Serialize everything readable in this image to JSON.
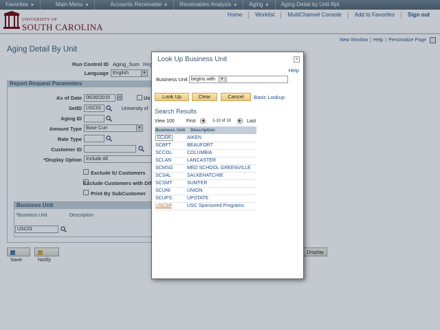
{
  "topnav": {
    "items": [
      {
        "label": "Favorites",
        "dropdown": true
      },
      {
        "label": "Main Menu",
        "dropdown": true
      },
      {
        "label": "Accounts Receivable",
        "dropdown": true
      },
      {
        "label": "Receivables Analysis",
        "dropdown": true
      },
      {
        "label": "Aging",
        "dropdown": true
      },
      {
        "label": "Aging Detail by Unit Rpt",
        "dropdown": false
      }
    ]
  },
  "header": {
    "logo_line1": "UNIVERSITY OF",
    "logo_line2": "SOUTH CAROLINA",
    "links": {
      "home": "Home",
      "worklist": "Worklist",
      "multichannel": "MultiChannel Console",
      "favorites": "Add to Favorites",
      "signout": "Sign out"
    }
  },
  "sublinks": {
    "new_window": "New Window",
    "help": "Help",
    "personalize": "Personalize Page",
    "sep": "|"
  },
  "page": {
    "title": "Aging Detail By Unit",
    "run_control_label": "Run Control ID",
    "run_control_value": "Aging_Sum",
    "run_control_link": "Rep",
    "language_label": "Language",
    "language_value": "English",
    "section_title": "Report Request Parameters",
    "as_of_date_label": "As of Date",
    "as_of_date_value": "06/30/2015",
    "cal_icon_text": "31",
    "use_label": "Us",
    "setid_label": "SetID",
    "setid_value": "USC01",
    "setid_desc": "University of",
    "aging_id_label": "Aging ID",
    "amount_type_label": "Amount Type",
    "amount_type_value": "Base Curr",
    "rate_type_label": "Rate Type",
    "customer_id_label": "Customer ID",
    "display_option_label": "*Display Option",
    "display_option_value": "Include All",
    "exclude_iu_label": "Exclude IU Customers",
    "exclude_cust_label": "Exclude Customers with Dif",
    "print_sub_label": "Print By SubCustomer",
    "bu_section_title": "Business Unit",
    "bu_col1": "*Business Unit",
    "bu_col2": "Description",
    "bu_value": "USC01"
  },
  "bottom": {
    "save": "Save",
    "notify": "Notify",
    "display": "Display"
  },
  "modal": {
    "title": "Look Up Business Unit",
    "close": "×",
    "help": "Help",
    "field_label": "Business Unit",
    "operator": "begins with",
    "search_value": "",
    "buttons": {
      "lookup": "Look Up",
      "clear": "Clear",
      "cancel": "Cancel",
      "basic": "Basic Lookup"
    },
    "results_title": "Search Results",
    "view_label": "View 100",
    "first_label": "First",
    "range_label": "1-10 of 10",
    "last_label": "Last",
    "columns": [
      "Business Unit",
      "Description"
    ],
    "rows": [
      {
        "code": "SCAIK",
        "desc": "AIKEN"
      },
      {
        "code": "SCBFT",
        "desc": "BEAUFORT"
      },
      {
        "code": "SCCOL",
        "desc": "COLUMBIA"
      },
      {
        "code": "SCLAN",
        "desc": "LANCASTER"
      },
      {
        "code": "SCMSG",
        "desc": "MED SCHOOL GREENVILLE"
      },
      {
        "code": "SCSAL",
        "desc": "SALKEHATCHIE"
      },
      {
        "code": "SCSMT",
        "desc": "SUMTER"
      },
      {
        "code": "SCUNI",
        "desc": "UNION"
      },
      {
        "code": "SCUPS",
        "desc": "UPSTATE"
      },
      {
        "code": "USCSP",
        "desc": "USC Sponsored Programs"
      }
    ]
  }
}
